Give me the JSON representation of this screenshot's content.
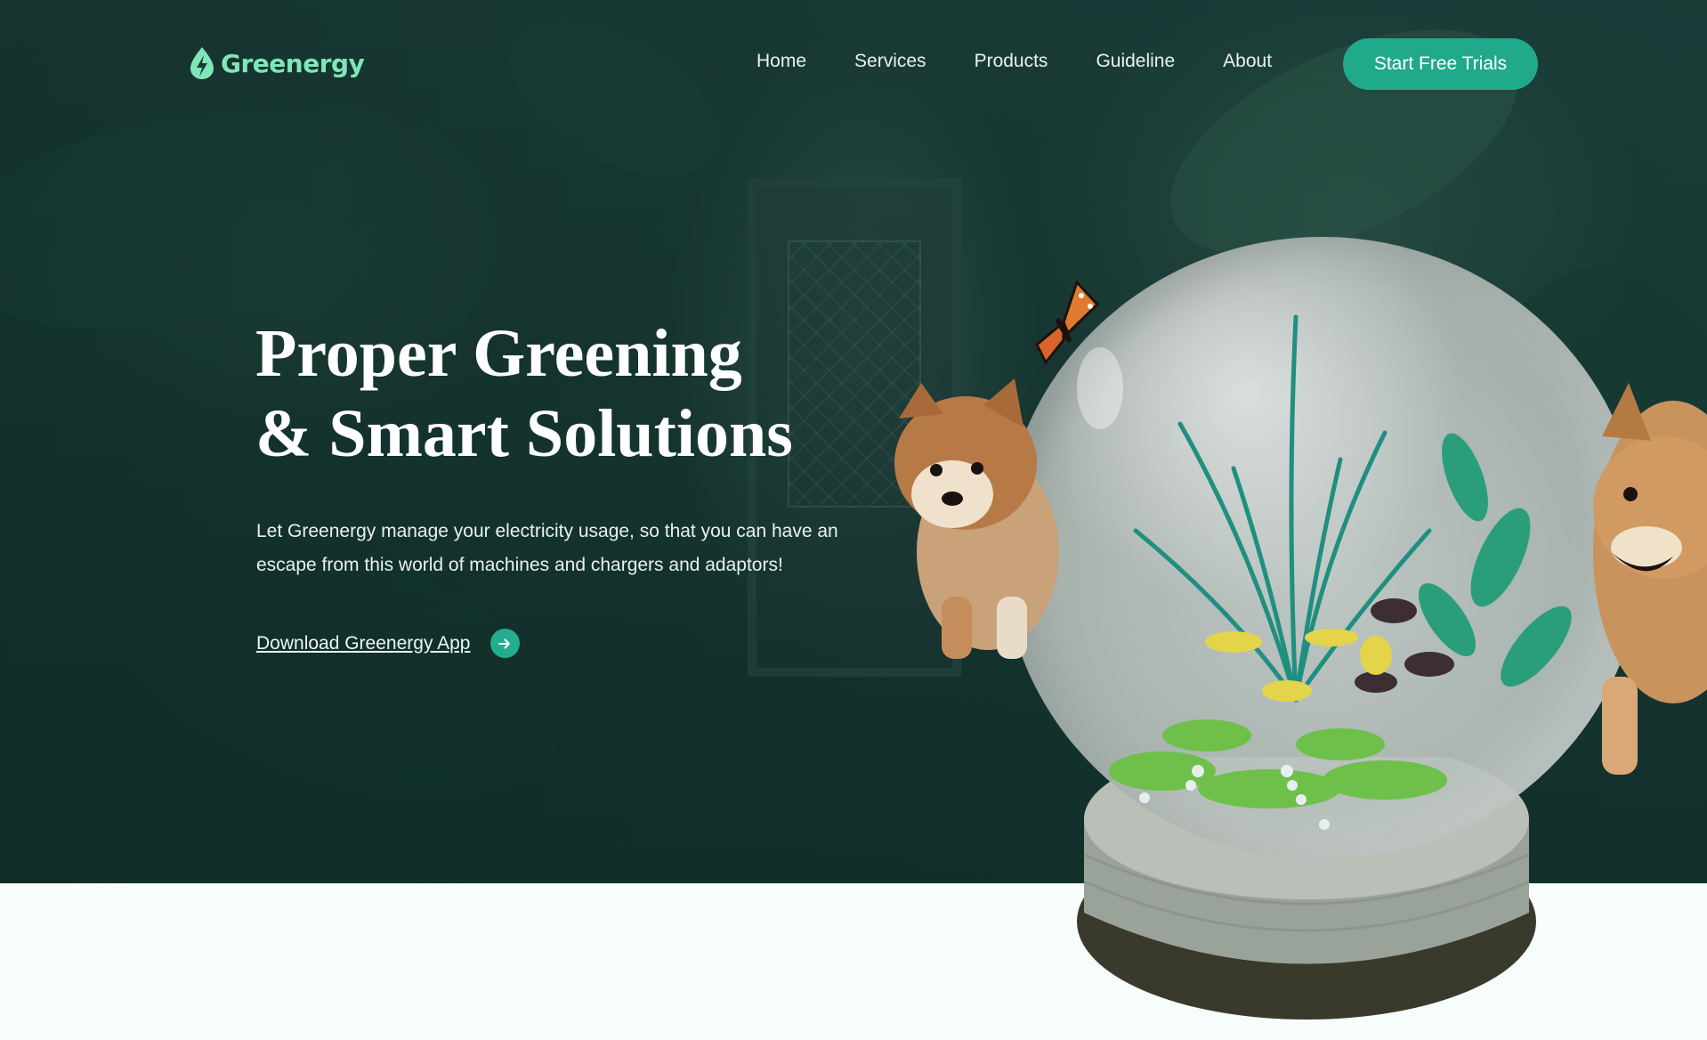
{
  "brand": {
    "name": "Greenergy",
    "accent": "#21a98c",
    "logo_color": "#7fe6b8"
  },
  "nav": {
    "items": [
      {
        "label": "Home"
      },
      {
        "label": "Services"
      },
      {
        "label": "Products"
      },
      {
        "label": "Guideline"
      },
      {
        "label": "About"
      }
    ],
    "cta_label": "Start Free Trials"
  },
  "hero": {
    "title_line1": "Proper Greening",
    "title_line2": "& Smart Solutions",
    "subtitle": "Let Greenergy manage your electricity usage, so that you can have an escape from this world of machines and chargers and adaptors!",
    "download_label": "Download Greenergy App",
    "download_icon": "arrow-right-icon"
  }
}
